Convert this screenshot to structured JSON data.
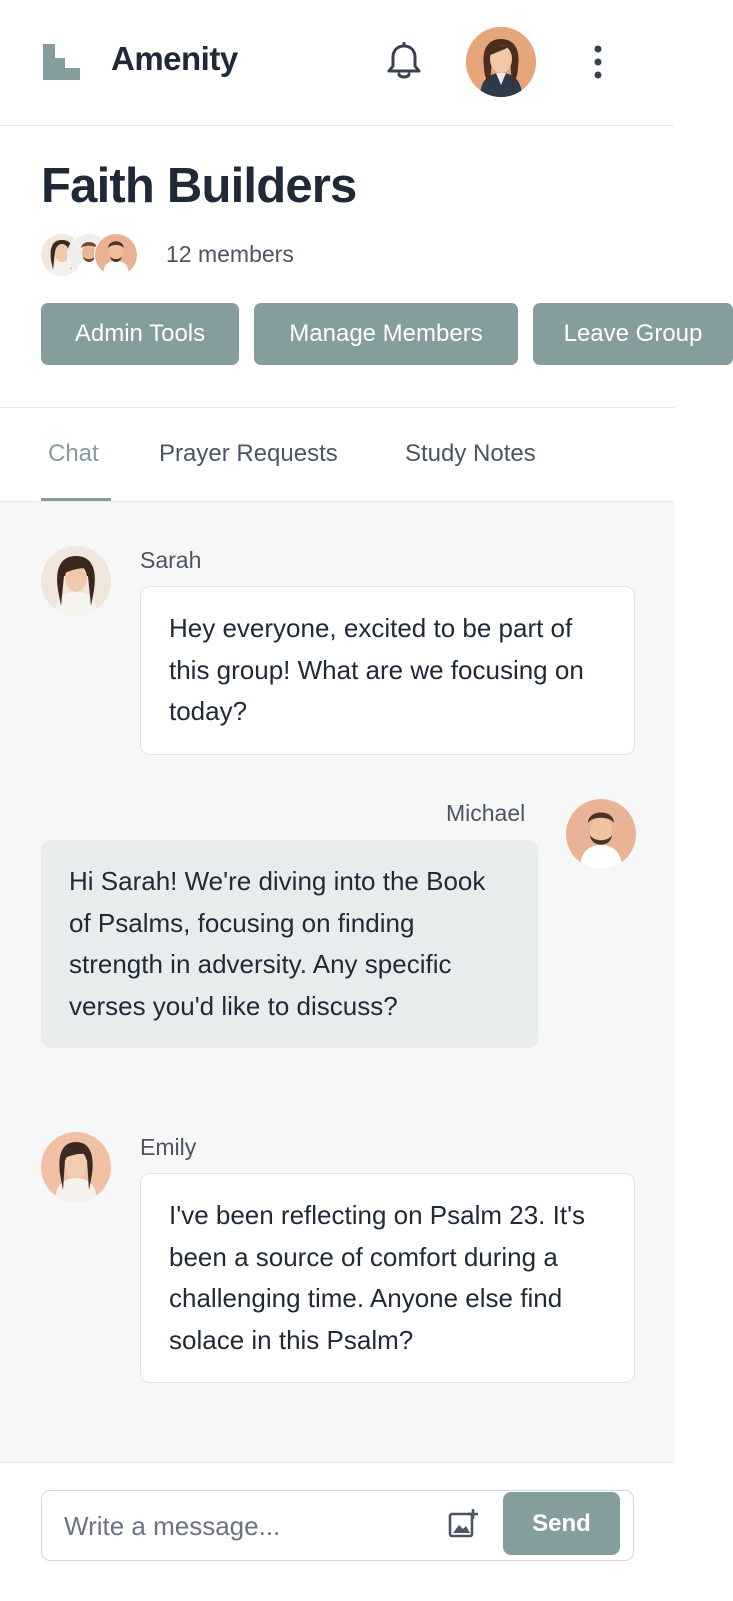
{
  "app": {
    "name": "Amenity"
  },
  "group": {
    "title": "Faith Builders",
    "members_count": "12 members"
  },
  "actions": {
    "admin_tools": "Admin Tools",
    "manage_members": "Manage Members",
    "leave_group": "Leave Group"
  },
  "tabs": [
    {
      "label": "Chat",
      "active": true
    },
    {
      "label": "Prayer Requests",
      "active": false
    },
    {
      "label": "Study Notes",
      "active": false
    }
  ],
  "messages": [
    {
      "sender": "Sarah",
      "text": "Hey everyone, excited to be part of this group! What are we focusing on today?",
      "side": "incoming"
    },
    {
      "sender": "Michael",
      "text": "Hi Sarah! We're diving into the Book of Psalms, focusing on finding strength in adversity. Any specific verses you'd like to discuss?",
      "side": "outgoing"
    },
    {
      "sender": "Emily",
      "text": "I've been reflecting on Psalm 23. It's been a source of comfort during a challenging time. Anyone else find solace in this Psalm?",
      "side": "incoming"
    }
  ],
  "composer": {
    "placeholder": "Write a message...",
    "value": "",
    "send_label": "Send"
  },
  "icons": {
    "logo": "stairs-logo-icon",
    "bell": "bell-icon",
    "menu": "more-vertical-icon",
    "attach": "add-image-icon"
  },
  "colors": {
    "accent": "#869d9e",
    "text": "#1f2937",
    "muted": "#4b5563",
    "chat_bg": "#f7f7f7",
    "outgoing_bubble": "#e8ecec"
  }
}
